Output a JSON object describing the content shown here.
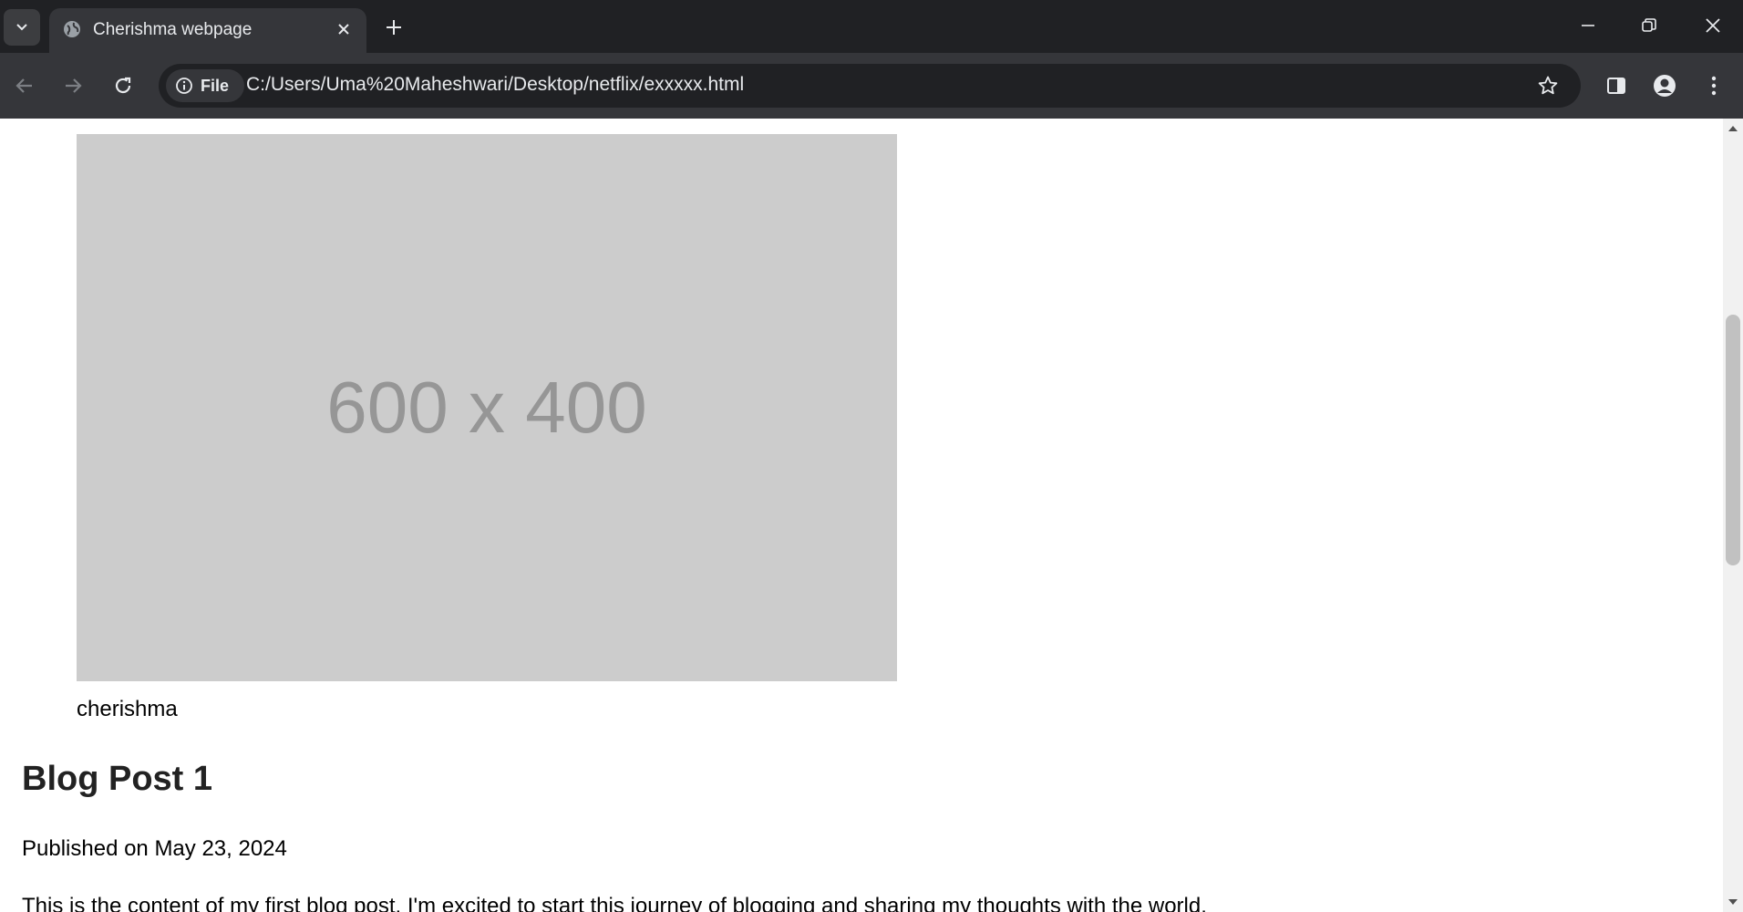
{
  "browser": {
    "tab": {
      "title": "Cherishma webpage",
      "favicon": "globe-icon"
    },
    "address_bar": {
      "chip_label": "File",
      "url": "C:/Users/Uma%20Maheshwari/Desktop/netflix/exxxxx.html"
    },
    "colors": {
      "tabstrip": "#202124",
      "toolbar": "#35363a",
      "text": "#e8eaed"
    }
  },
  "page": {
    "image": {
      "placeholder_text": "600 x 400",
      "caption": "cherishma",
      "background": "#cccccc"
    },
    "post": {
      "title": "Blog Post 1",
      "date": "Published on May 23, 2024",
      "body": "This is the content of my first blog post. I'm excited to start this journey of blogging and sharing my thoughts with the world."
    }
  }
}
